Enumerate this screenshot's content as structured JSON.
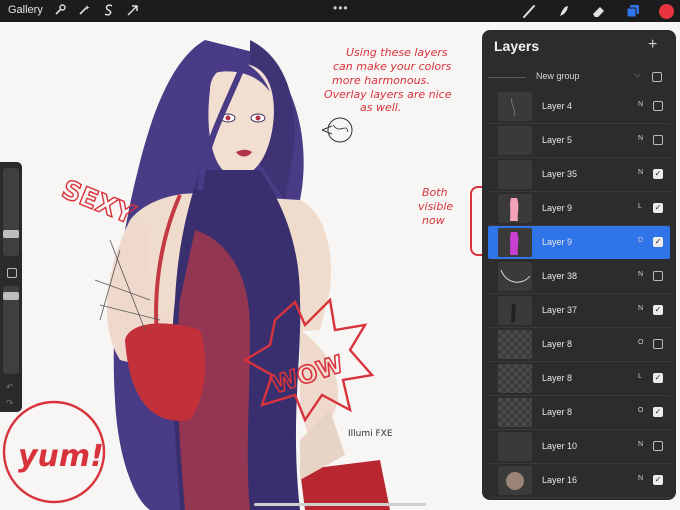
{
  "topbar": {
    "gallery_label": "Gallery",
    "left_tools": [
      "wrench-icon",
      "magic-wand-icon",
      "selection-s-icon",
      "move-arrow-icon"
    ],
    "right_tools": [
      "brush-icon",
      "smudge-icon",
      "eraser-icon",
      "layers-icon",
      "color-swatch"
    ],
    "menu_dots": "•••",
    "color_accent": "#e8343f",
    "layers_icon_color": "#2f74e8"
  },
  "layers_panel": {
    "title": "Layers",
    "add_icon": "plus-icon",
    "group": {
      "name": "New group",
      "checked": false
    },
    "rows": [
      {
        "name": "Layer 4",
        "mode": "N",
        "checked": false,
        "thumb": "sketch"
      },
      {
        "name": "Layer 5",
        "mode": "N",
        "checked": false,
        "thumb": "dark"
      },
      {
        "name": "Layer 35",
        "mode": "N",
        "checked": true,
        "thumb": "dark"
      },
      {
        "name": "Layer 9",
        "mode": "L",
        "checked": true,
        "thumb": "pink-figure"
      },
      {
        "name": "Layer 9",
        "mode": "D",
        "checked": true,
        "thumb": "magenta-figure",
        "selected": true
      },
      {
        "name": "Layer 38",
        "mode": "N",
        "checked": false,
        "thumb": "curve"
      },
      {
        "name": "Layer 37",
        "mode": "N",
        "checked": true,
        "thumb": "dark-figure"
      },
      {
        "name": "Layer 8",
        "mode": "O",
        "checked": false,
        "thumb": "checker"
      },
      {
        "name": "Layer 8",
        "mode": "L",
        "checked": true,
        "thumb": "checker"
      },
      {
        "name": "Layer 8",
        "mode": "O",
        "checked": true,
        "thumb": "checker"
      },
      {
        "name": "Layer 10",
        "mode": "N",
        "checked": false,
        "thumb": "dark"
      },
      {
        "name": "Layer 16",
        "mode": "N",
        "checked": true,
        "thumb": "blob"
      }
    ]
  },
  "annotations": {
    "note_lines": [
      "Using these layers",
      "can make your colors",
      "more harmonous.",
      "Overlay layers are nice",
      "as well."
    ],
    "both_visible_lines": [
      "Both",
      "visible",
      "now"
    ],
    "sexy": "SEXY",
    "wow": "WOW",
    "yum": "yum!",
    "signature": "Illumi\nFXE",
    "ink_color": "#d8333c"
  }
}
